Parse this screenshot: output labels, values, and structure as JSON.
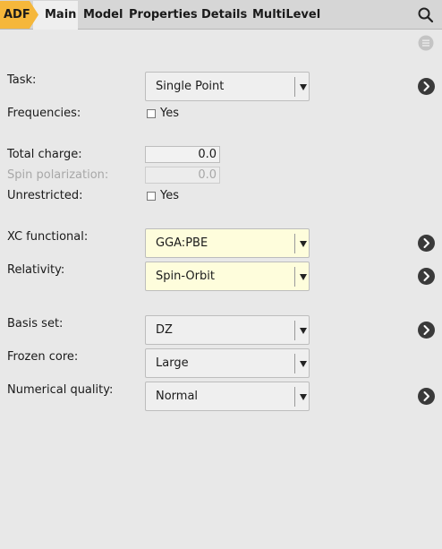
{
  "tabs": {
    "adf": "ADF",
    "main": "Main",
    "model": "Model",
    "properties": "Properties",
    "details": "Details",
    "multilevel": "MultiLevel"
  },
  "form": {
    "task": {
      "label": "Task:",
      "value": "Single Point"
    },
    "frequencies": {
      "label": "Frequencies:",
      "checkbox": "Yes",
      "checked": false
    },
    "total_charge": {
      "label": "Total charge:",
      "value": "0.0"
    },
    "spin_polarization": {
      "label": "Spin polarization:",
      "value": "0.0"
    },
    "unrestricted": {
      "label": "Unrestricted:",
      "checkbox": "Yes",
      "checked": false
    },
    "xc_functional": {
      "label": "XC functional:",
      "value": "GGA:PBE"
    },
    "relativity": {
      "label": "Relativity:",
      "value": "Spin-Orbit"
    },
    "basis_set": {
      "label": "Basis set:",
      "value": "DZ"
    },
    "frozen_core": {
      "label": "Frozen core:",
      "value": "Large"
    },
    "numerical_quality": {
      "label": "Numerical quality:",
      "value": "Normal"
    }
  },
  "colors": {
    "adf_badge": "#f5b73b",
    "highlight_field": "#fefddc",
    "go_button": "#3a3a3a"
  },
  "icons": {
    "search": "search-icon",
    "panel_menu": "menu-icon",
    "details": "chevron-right-icon"
  }
}
